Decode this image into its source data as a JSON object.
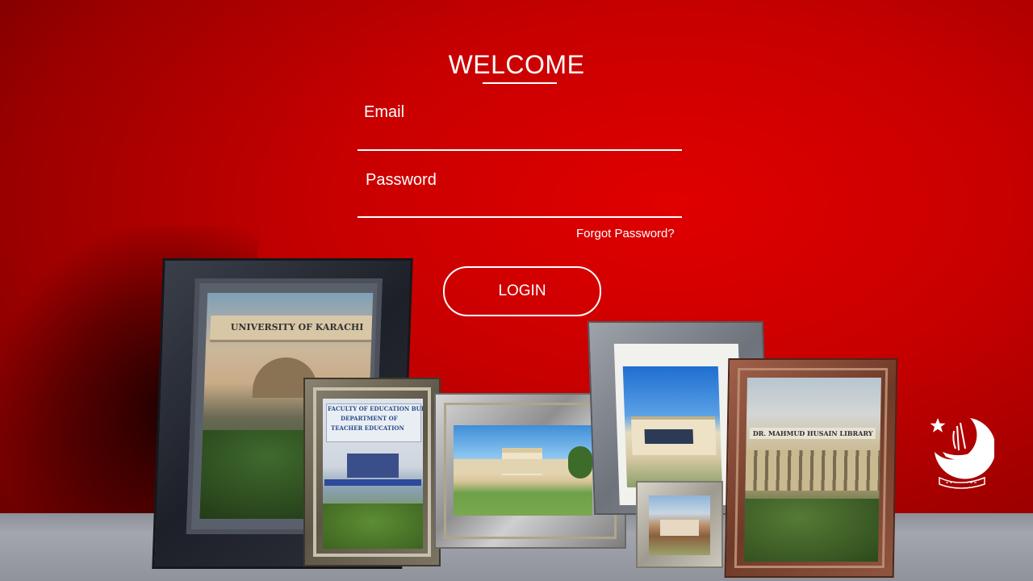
{
  "login": {
    "title": "WELCOME",
    "email_label": "Email",
    "password_label": "Password",
    "forgot_label": "Forgot Password?",
    "login_label": "LOGIN"
  },
  "photos": {
    "karachi_sign": "UNIVERSITY OF KARACHI",
    "education_sign_line1": "FACULTY OF EDUCATION BUILDING",
    "education_sign_line2": "DEPARTMENT OF",
    "education_sign_line3": "TEACHER EDUCATION",
    "library_sign": "DR. MAHMUD HUSAIN LIBRARY"
  },
  "colors": {
    "background": "#c80000",
    "text": "#ffffff"
  }
}
